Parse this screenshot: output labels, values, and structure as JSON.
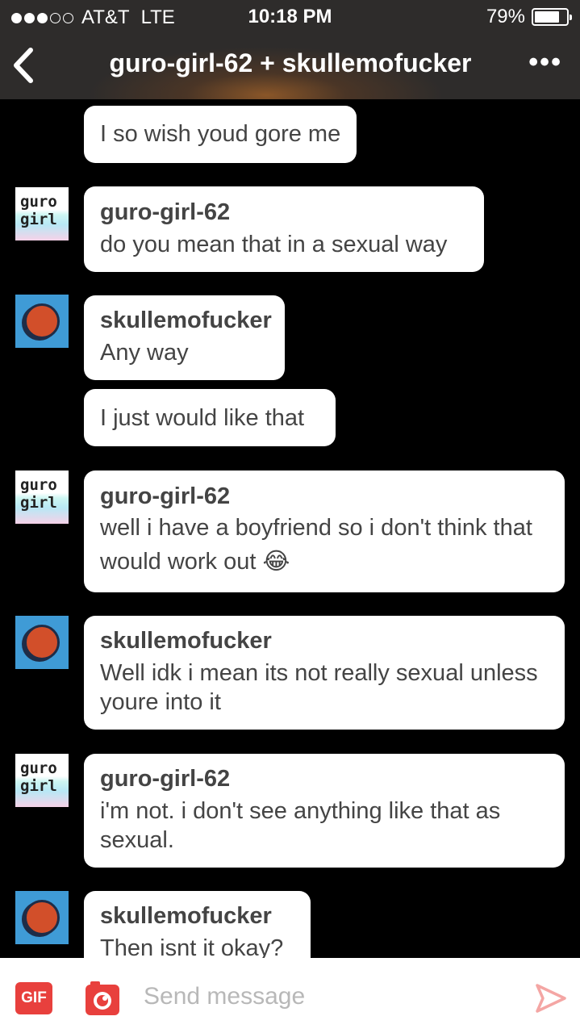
{
  "status_bar": {
    "carrier": "AT&T",
    "network": "LTE",
    "time": "10:18 PM",
    "battery": "79%",
    "battery_level": 0.79
  },
  "header": {
    "title": "guro-girl-62 + skullemofucker",
    "back_icon": "chevron-left-icon",
    "more_icon": "more-dots-icon",
    "more_label": "•••"
  },
  "avatars": {
    "guro_line1": "guro",
    "guro_line2": "girl"
  },
  "messages": [
    {
      "sender": "",
      "text": "I so wish youd gore me"
    },
    {
      "sender": "guro-girl-62",
      "text": "do you mean that in a sexual way"
    },
    {
      "sender": "skullemofucker",
      "text": "Any way"
    },
    {
      "sender": "",
      "text": "I just would like that"
    },
    {
      "sender": "guro-girl-62",
      "text": "well i have a boyfriend so i don't think that would work out 😂"
    },
    {
      "sender": "skullemofucker",
      "text": "Well idk i mean its not really sexual unless youre into it"
    },
    {
      "sender": "guro-girl-62",
      "text": "i'm not. i don't see anything like that as sexual."
    },
    {
      "sender": "skullemofucker",
      "text": "Then isnt it okay?"
    }
  ],
  "composer": {
    "gif_label": "GIF",
    "camera_icon": "camera-icon",
    "placeholder": "Send message",
    "send_icon": "send-icon"
  },
  "colors": {
    "accent_red": "#e8403d",
    "avatar_blue": "#3f9bd6",
    "background": "#000000",
    "bubble": "#ffffff"
  }
}
